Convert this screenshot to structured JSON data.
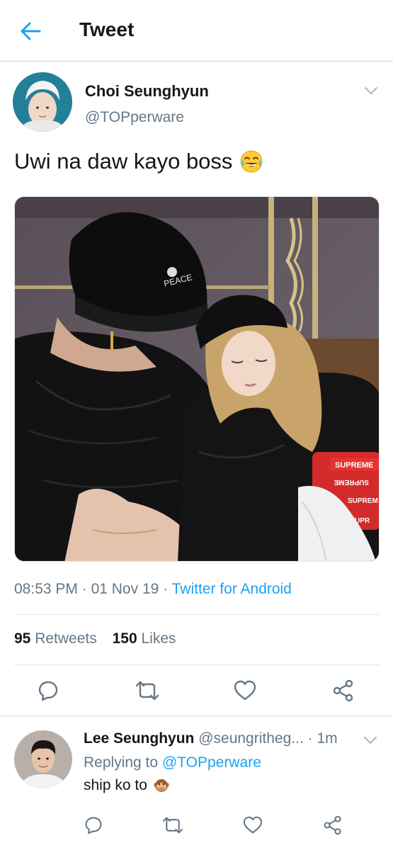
{
  "header": {
    "title": "Tweet",
    "back_icon": "arrow-left-icon",
    "accent": "#1da1f2"
  },
  "tweet": {
    "author_name": "Choi Seunghyun",
    "author_handle": "@TOPperware",
    "text": "Uwi na daw kayo boss",
    "emoji": "😂",
    "emoji_icon": "face-with-tears-of-joy-icon",
    "time": "08:53 PM",
    "sep1": "·",
    "date": "01 Nov 19",
    "sep2": "·",
    "source": "Twitter for Android",
    "retweets_count": "95",
    "retweets_label": "Retweets",
    "likes_count": "150",
    "likes_label": "Likes"
  },
  "reply": {
    "author_name": "Lee Seunghyun",
    "author_handle": "@seungritheg...",
    "sep": "·",
    "time": "1m",
    "replying_to_label": "Replying to",
    "replying_to_handle": "@TOPperware",
    "text": "ship ko to",
    "emoji": "🙊",
    "emoji_icon": "monkey-icon"
  },
  "colors": {
    "text_primary": "#14171a",
    "text_secondary": "#657786",
    "link": "#1da1f2",
    "divider": "#e1e8ed"
  }
}
